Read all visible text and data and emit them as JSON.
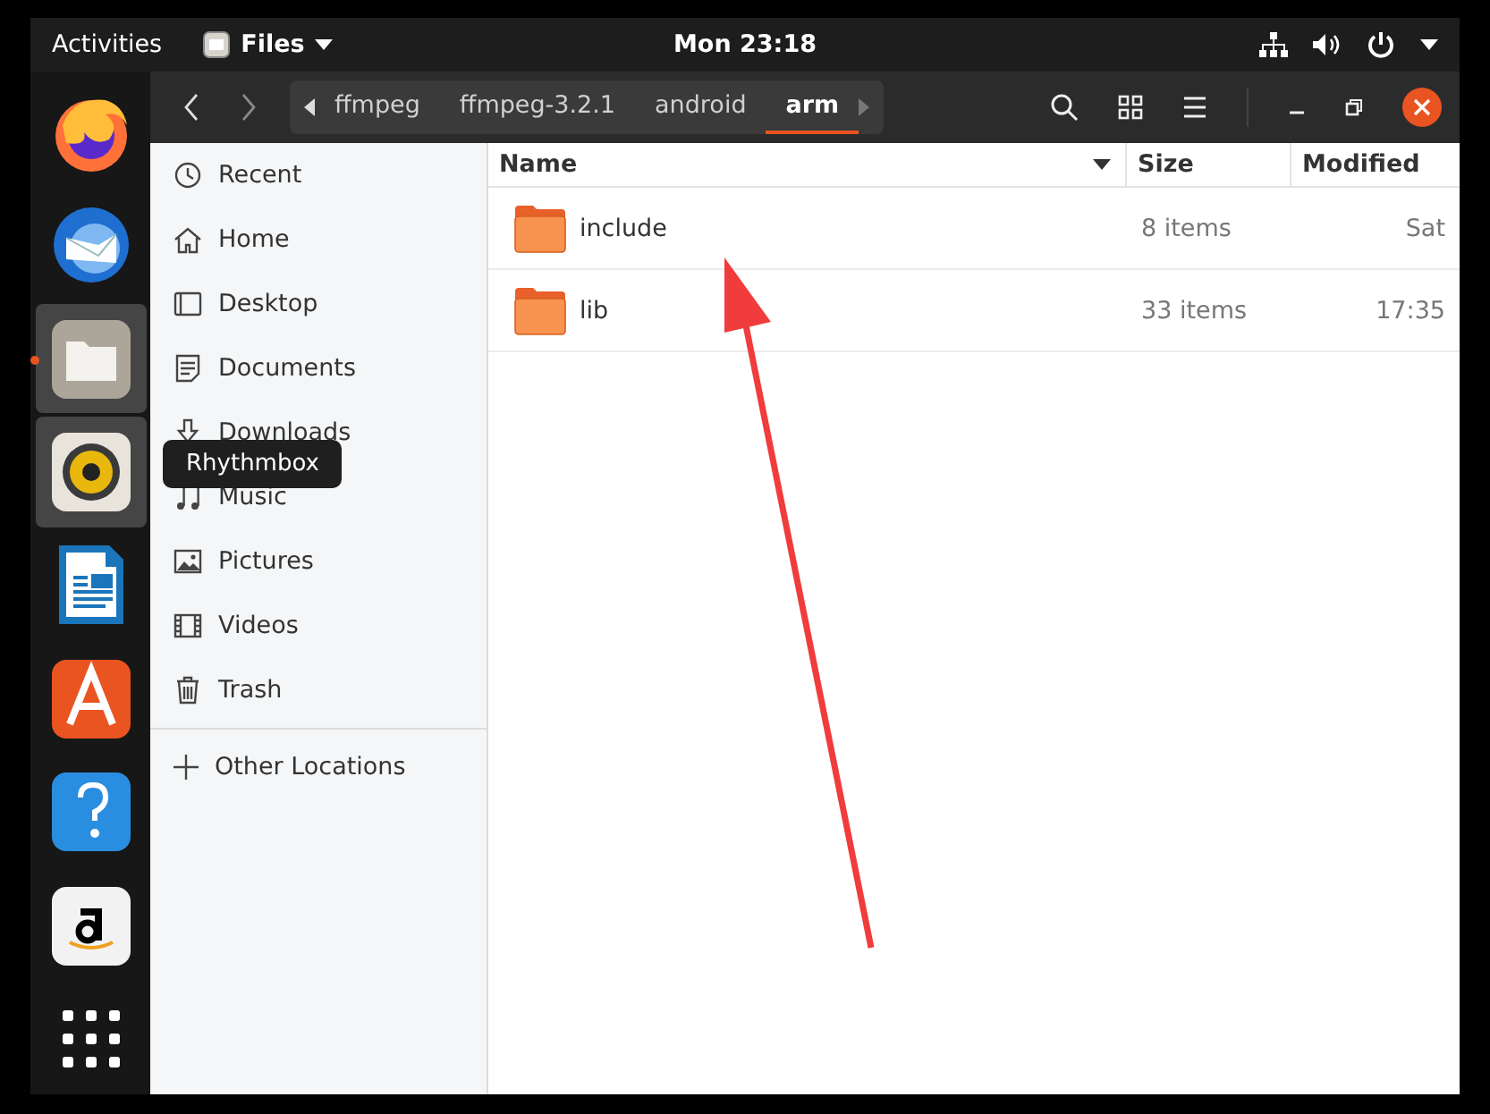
{
  "top_bar": {
    "activities": "Activities",
    "app_menu": "Files",
    "clock": "Mon 23:18"
  },
  "dock": [
    {
      "kind": "firefox",
      "running": false,
      "highlighted": false
    },
    {
      "kind": "thunderbird",
      "running": false,
      "highlighted": false
    },
    {
      "kind": "files",
      "running": true,
      "highlighted": true
    },
    {
      "kind": "rhythmbox",
      "running": false,
      "highlighted": true
    },
    {
      "kind": "writer",
      "running": false,
      "highlighted": false
    },
    {
      "kind": "software",
      "running": false,
      "highlighted": false
    },
    {
      "kind": "help",
      "running": false,
      "highlighted": false
    },
    {
      "kind": "amazon",
      "running": false,
      "highlighted": false
    },
    {
      "kind": "apps",
      "running": false,
      "highlighted": false
    }
  ],
  "tooltip": "Rhythmbox",
  "pathbar": [
    {
      "label": "ffmpeg",
      "selected": false
    },
    {
      "label": "ffmpeg-3.2.1",
      "selected": false
    },
    {
      "label": "android",
      "selected": false
    },
    {
      "label": "arm",
      "selected": true
    }
  ],
  "sidebar": {
    "items": [
      {
        "kind": "recent",
        "label": "Recent"
      },
      {
        "kind": "home",
        "label": "Home"
      },
      {
        "kind": "desktop",
        "label": "Desktop"
      },
      {
        "kind": "documents",
        "label": "Documents"
      },
      {
        "kind": "downloads",
        "label": "Downloads"
      },
      {
        "kind": "music",
        "label": "Music"
      },
      {
        "kind": "pictures",
        "label": "Pictures"
      },
      {
        "kind": "videos",
        "label": "Videos"
      },
      {
        "kind": "trash",
        "label": "Trash"
      }
    ],
    "other": "Other Locations"
  },
  "table": {
    "columns": [
      {
        "label": "Name",
        "sorted": true
      },
      {
        "label": "Size",
        "sorted": false
      },
      {
        "label": "Modified",
        "sorted": false
      }
    ],
    "rows": [
      {
        "name": "include",
        "size": "8 items",
        "modified": "Sat"
      },
      {
        "name": "lib",
        "size": "33 items",
        "modified": "17:35"
      }
    ]
  }
}
